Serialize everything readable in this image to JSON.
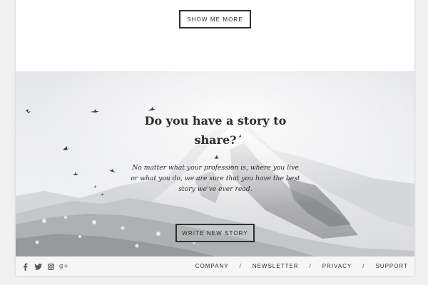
{
  "top": {
    "show_more_label": "SHOW ME MORE"
  },
  "hero": {
    "title": "Do you have a story to share?",
    "description": "No matter what your profession is, where you live or what you do, we are sure that you have the best story we've ever read.",
    "cta_label": "WRITE NEW STORY"
  },
  "footer": {
    "social": [
      "facebook-icon",
      "twitter-icon",
      "instagram-icon",
      "google-plus-icon"
    ],
    "google_plus_glyph": "g+",
    "nav": [
      {
        "label": "COMPANY"
      },
      {
        "label": "NEWSLETTER"
      },
      {
        "label": "PRIVACY"
      },
      {
        "label": "SUPPORT"
      }
    ],
    "separator": "/"
  },
  "colors": {
    "button_border": "#2f2f2f",
    "text": "#2c2c2c",
    "footer_bg": "#f6f6f6",
    "page_bg": "#f1f1f1"
  }
}
